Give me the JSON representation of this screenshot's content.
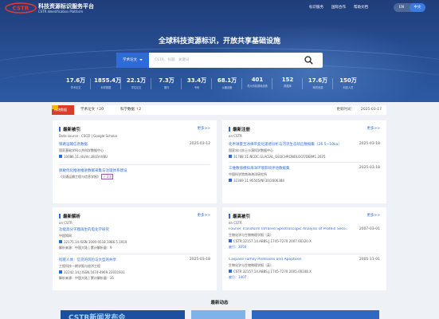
{
  "header": {
    "site_title": "科技资源标识服务平台",
    "site_subtitle": "CSTR Identification Platform",
    "logo_text": "CSTR",
    "nav": [
      "标识服务",
      "国际合作",
      "帮助文档"
    ],
    "lang": [
      "EN",
      "中文"
    ]
  },
  "hero": {
    "slogan": "全球科技资源标识，开放共享基础设施",
    "search_type": "学术论文",
    "search_placeholder": "CSTR、标题、关键词"
  },
  "stats": [
    {
      "value": "17.6万",
      "label": "学术论文"
    },
    {
      "value": "1855.4万",
      "label": "科学数据"
    },
    {
      "value": "22.1万",
      "label": "学位论文"
    },
    {
      "value": "7.3万",
      "label": "期刊"
    },
    {
      "value": "33.4万",
      "label": "专利"
    },
    {
      "value": "68.1万",
      "label": "仪器设备"
    },
    {
      "value": "401",
      "label": "重大科技基础设施"
    },
    {
      "value": "152",
      "label": "数据库"
    },
    {
      "value": "17.6万",
      "label": "种质资源"
    },
    {
      "value": "150万",
      "label": "科技人员"
    }
  ],
  "statusbar": {
    "tag": "畅增数据",
    "items": [
      {
        "label": "学术论文",
        "arrow": "↑",
        "count": "20"
      },
      {
        "label": "科学数据",
        "arrow": "↑",
        "count": "2"
      }
    ],
    "update_label": "更新时间：",
    "update_time": "2025-03-17"
  },
  "cards": {
    "latest_citations": {
      "title": "最新被引",
      "more": "更多>>",
      "source": "Data source : CSCD | Google Scholar",
      "entries": [
        {
          "title": "铁路运输信息数据",
          "date": "2025-03-12",
          "meta": "国家基础学科公共科学数据中心",
          "id": "10086.11.rds/dc.zB/ZmV8U"
        },
        {
          "title": "脱敏优化推进推进数据采集与治理体系建设",
          "meta": "《交通运输工程与信息学报》",
          "tag": "✓ 2次"
        }
      ]
    },
    "latest_registrations": {
      "title": "最新注册",
      "more": "更多>>",
      "source": "on CSTR",
      "entries": [
        {
          "title": "北半球夏至冰缘带变化遥感分析与河流生态响应数据集（26.5~10ka）",
          "date": "2025-03-18",
          "meta": "国家冰川冻土沙漠科学数据中心",
          "id": "31788.11.NCDC.GLACIAL_GEOCHRONOLOGY/DB/M1.2025"
        },
        {
          "title": "三维数值模拟海洋环境影响评估数据集",
          "date": "2025-03-18",
          "meta": "中国科学院南海海洋研究所",
          "id": "32369.11.95505/NF30/2606384"
        }
      ]
    },
    "latest_resolutions": {
      "title": "最新解析",
      "more": "更多>>",
      "source": "on CSTR",
      "entries": [
        {
          "title": "功能高分子膜再生的电化学研究",
          "date": "",
          "meta": "中国知网",
          "id": "32175.14.ISSN.1000-0518.1986.5.1919",
          "extra": "解析来源：中国大陆 | 累计解析量：9"
        },
        {
          "title": "彻底人体：信贷的风险与大型的共享",
          "date": "2025-03-18",
          "meta": "工程科技一期学报与经济工程",
          "id": "32242.14.J.ISSN.1674-4969.22031931",
          "extra": "解析来源：中国大陆 | 累计解析量：35"
        }
      ]
    },
    "highest_citations": {
      "title": "最高被引",
      "more": "更多>>",
      "source": "on CSTR",
      "entries": [
        {
          "title": "Fourier Transform Infrared Spectroscopic Analysis of Protein Seco...",
          "date": "2007-03-01",
          "meta": "生物化学与生物物理学报（英）",
          "id": "CSTR:32157.14.ABBS.J.1745-7270.2007.00320.X",
          "extra": "被引：3050"
        },
        {
          "title": "Caspase Family Proteases and Apoptosis",
          "date": "2005-11-01",
          "meta": "生物化学与生物物理学报（英）",
          "id": "CSTR:32157.14.ABBS.J.1745-7270.2005.00108.X",
          "extra": "被引：1407"
        }
      ]
    }
  },
  "news": {
    "title": "最新动态",
    "banner_text": "CSTR新闻发布会"
  },
  "colors": {
    "primary": "#2f6bd6",
    "hero_dark": "#1f3e7a",
    "accent_red": "#d93d2a",
    "background": "#eef1f6"
  }
}
